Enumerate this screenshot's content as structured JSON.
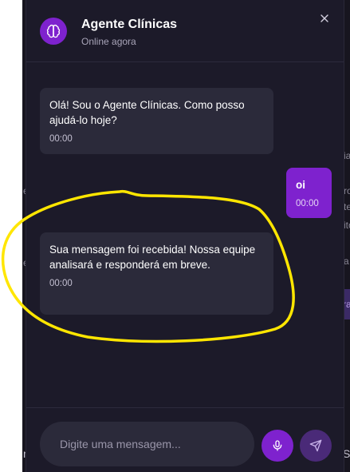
{
  "header": {
    "title": "Agente Clínicas",
    "status": "Online agora"
  },
  "messages": [
    {
      "sender": "bot",
      "text": "Olá! Sou o Agente Clínicas. Como posso ajudá-lo hoje?",
      "time": "00:00"
    },
    {
      "sender": "user",
      "text": "oi",
      "time": "00:00"
    },
    {
      "sender": "bot",
      "text": "Sua mensagem foi recebida! Nossa equipe analisará e responderá em breve.",
      "time": "00:00"
    }
  ],
  "composer": {
    "placeholder": "Digite uma mensagem...",
    "mic_icon": "mic-icon",
    "send_icon": "send-icon"
  },
  "background_fragments": [
    "e",
    "e",
    "ia",
    "ro",
    "te",
    "ito",
    "a",
    "ra",
    "S",
    "n"
  ],
  "icons": {
    "avatar": "brain-icon",
    "close": "close-icon"
  },
  "colors": {
    "accent": "#7e22ce",
    "panel": "#1c1a29",
    "bubble_bot": "#2b2a3a",
    "annotation": "#ffe600"
  }
}
